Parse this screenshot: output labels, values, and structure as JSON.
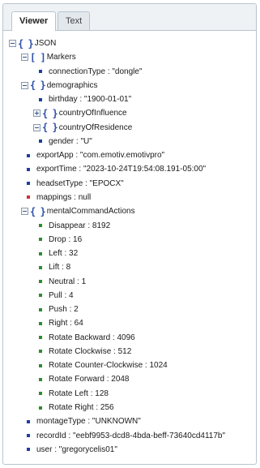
{
  "tabs": [
    {
      "label": "Viewer",
      "active": true
    },
    {
      "label": "Text",
      "active": false
    }
  ],
  "colors": {
    "value": "#1d3f9e",
    "null": "#d43030",
    "number": "#2e8b2e",
    "brace": "#2e50a8"
  },
  "tree": [
    {
      "label": "JSON",
      "kind": "object",
      "depth": 0,
      "expanded": true
    },
    {
      "label": "Markers",
      "kind": "array",
      "depth": 1,
      "expanded": true
    },
    {
      "label": "connectionType : \"dongle\"",
      "kind": "value",
      "depth": 2
    },
    {
      "label": "demographics",
      "kind": "object",
      "depth": 1,
      "expanded": true
    },
    {
      "label": "birthday : \"1900-01-01\"",
      "kind": "value",
      "depth": 2
    },
    {
      "label": "countryOfInfluence",
      "kind": "object",
      "depth": 2,
      "expanded": false
    },
    {
      "label": "countryOfResidence",
      "kind": "object",
      "depth": 2,
      "expanded": true
    },
    {
      "label": "gender : \"U\"",
      "kind": "value",
      "depth": 2
    },
    {
      "label": "exportApp : \"com.emotiv.emotivpro\"",
      "kind": "value",
      "depth": 1
    },
    {
      "label": "exportTime : \"2023-10-24T19:54:08.191-05:00\"",
      "kind": "value",
      "depth": 1
    },
    {
      "label": "headsetType : \"EPOCX\"",
      "kind": "value",
      "depth": 1
    },
    {
      "label": "mappings : null",
      "kind": "null",
      "depth": 1
    },
    {
      "label": "mentalCommandActions",
      "kind": "object",
      "depth": 1,
      "expanded": true
    },
    {
      "label": "Disappear : 8192",
      "kind": "number",
      "depth": 2
    },
    {
      "label": "Drop : 16",
      "kind": "number",
      "depth": 2
    },
    {
      "label": "Left : 32",
      "kind": "number",
      "depth": 2
    },
    {
      "label": "Lift : 8",
      "kind": "number",
      "depth": 2
    },
    {
      "label": "Neutral : 1",
      "kind": "number",
      "depth": 2
    },
    {
      "label": "Pull : 4",
      "kind": "number",
      "depth": 2
    },
    {
      "label": "Push : 2",
      "kind": "number",
      "depth": 2
    },
    {
      "label": "Right : 64",
      "kind": "number",
      "depth": 2
    },
    {
      "label": "Rotate Backward : 4096",
      "kind": "number",
      "depth": 2
    },
    {
      "label": "Rotate Clockwise : 512",
      "kind": "number",
      "depth": 2
    },
    {
      "label": "Rotate Counter-Clockwise : 1024",
      "kind": "number",
      "depth": 2
    },
    {
      "label": "Rotate Forward : 2048",
      "kind": "number",
      "depth": 2
    },
    {
      "label": "Rotate Left : 128",
      "kind": "number",
      "depth": 2
    },
    {
      "label": "Rotate Right : 256",
      "kind": "number",
      "depth": 2
    },
    {
      "label": "montageType : \"UNKNOWN\"",
      "kind": "value",
      "depth": 1
    },
    {
      "label": "recordId : \"eebf9953-dcd8-4bda-beff-73640cd4117b\"",
      "kind": "value",
      "depth": 1
    },
    {
      "label": "user : \"gregorycelis01\"",
      "kind": "value",
      "depth": 1
    }
  ]
}
